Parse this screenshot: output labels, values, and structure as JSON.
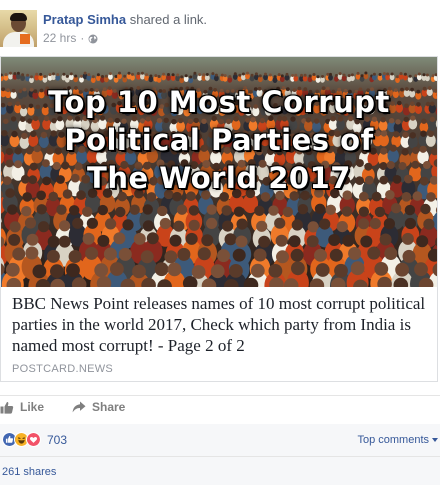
{
  "post": {
    "author": "Pratap Simha",
    "action": "shared a link.",
    "timestamp": "22 hrs",
    "separator": "·",
    "privacy_icon": "globe-icon"
  },
  "link_card": {
    "image_title_lines": [
      "Top 10 Most Corrupt",
      "Political Parties of",
      "The World 2017"
    ],
    "headline": "BBC News Point releases names of 10 most corrupt political parties in the world 2017, Check which party from India is named most corrupt! - Page 2 of 2",
    "domain": "POSTCARD.NEWS"
  },
  "actions": {
    "like_label": "Like",
    "share_label": "Share"
  },
  "reactions": {
    "icons": [
      "like-reaction-icon",
      "haha-reaction-icon",
      "love-reaction-icon"
    ],
    "count": "703",
    "sort_label": "Top comments"
  },
  "shares": {
    "label": "261 shares"
  },
  "colors": {
    "link_blue": "#365899",
    "like_blue": "#4267b2",
    "haha_yellow": "#f7b125",
    "love_red": "#f25268",
    "meta_gray": "#90949c"
  }
}
